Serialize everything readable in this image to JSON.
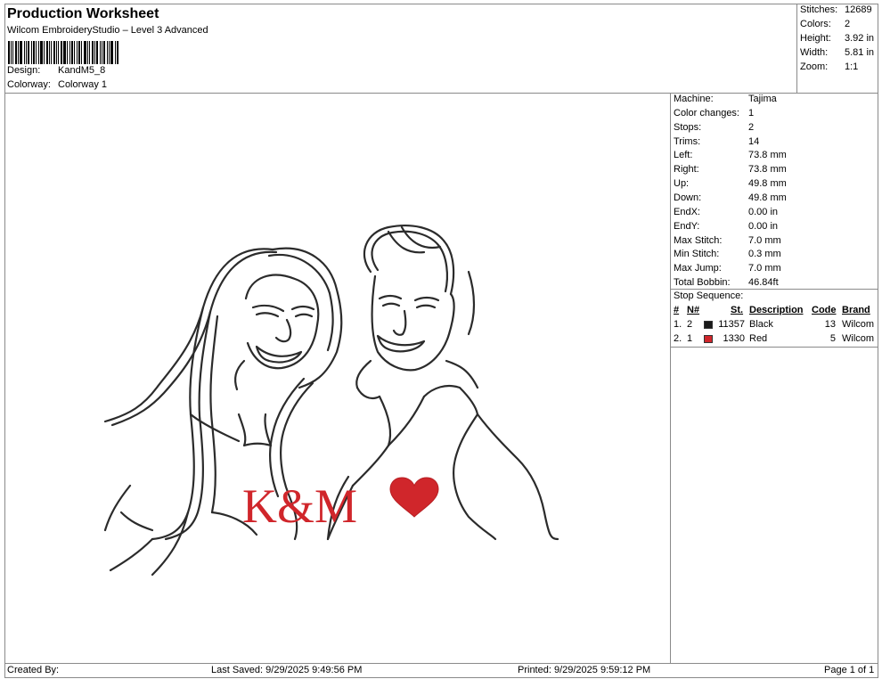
{
  "header": {
    "title": "Production Worksheet",
    "software": "Wilcom EmbroideryStudio – Level 3 Advanced",
    "design_label": "Design:",
    "design_value": "KandM5_8",
    "colorway_label": "Colorway:",
    "colorway_value": "Colorway 1"
  },
  "summary": {
    "stitches_label": "Stitches:",
    "stitches_value": "12689",
    "colors_label": "Colors:",
    "colors_value": "2",
    "height_label": "Height:",
    "height_value": "3.92 in",
    "width_label": "Width:",
    "width_value": "5.81 in",
    "zoom_label": "Zoom:",
    "zoom_value": "1:1"
  },
  "machine_info": [
    {
      "label": "Machine:",
      "value": "Tajima"
    },
    {
      "label": "Color changes:",
      "value": "1"
    },
    {
      "label": "Stops:",
      "value": "2"
    },
    {
      "label": "Trims:",
      "value": "14"
    },
    {
      "label": "Left:",
      "value": "73.8 mm"
    },
    {
      "label": "Right:",
      "value": "73.8 mm"
    },
    {
      "label": "Up:",
      "value": "49.8 mm"
    },
    {
      "label": "Down:",
      "value": "49.8 mm"
    },
    {
      "label": "EndX:",
      "value": "0.00 in"
    },
    {
      "label": "EndY:",
      "value": "0.00 in"
    },
    {
      "label": "Max Stitch:",
      "value": "7.0 mm"
    },
    {
      "label": "Min Stitch:",
      "value": "0.3 mm"
    },
    {
      "label": "Max Jump:",
      "value": "7.0 mm"
    },
    {
      "label": "Total Bobbin:",
      "value": "46.84ft"
    }
  ],
  "stop_sequence": {
    "title": "Stop Sequence:",
    "headers": {
      "idx": "#",
      "n": "N#",
      "st": "St.",
      "desc": "Description",
      "code": "Code",
      "brand": "Brand"
    },
    "rows": [
      {
        "idx": "1.",
        "n": "2",
        "color": "#1a1a1a",
        "st": "11357",
        "desc": "Black",
        "code": "13",
        "brand": "Wilcom"
      },
      {
        "idx": "2.",
        "n": "1",
        "color": "#d0262b",
        "st": "1330",
        "desc": "Red",
        "code": "5",
        "brand": "Wilcom"
      }
    ]
  },
  "design": {
    "monogram": "K&M",
    "line_color": "#2b2b2b",
    "accent_color": "#d0262b"
  },
  "footer": {
    "created_by": "Created By:",
    "last_saved": "Last Saved: 9/29/2025 9:49:56 PM",
    "printed": "Printed: 9/29/2025 9:59:12 PM",
    "page": "Page 1 of 1"
  }
}
